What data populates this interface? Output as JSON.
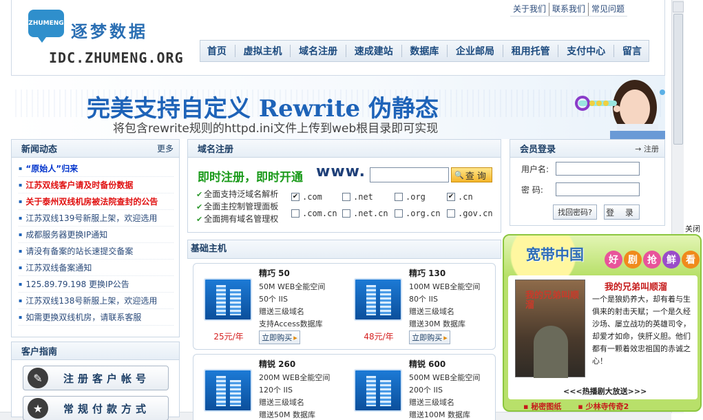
{
  "logo": {
    "bubble": "ZHUMENG",
    "cn": "逐梦数据",
    "en": "IDC.ZHUMENG.ORG"
  },
  "toplinks": [
    "关于我们",
    "联系我们",
    "常见问题"
  ],
  "nav": [
    "首页",
    "虚拟主机",
    "域名注册",
    "速成建站",
    "数据库",
    "企业邮局",
    "租用托管",
    "支付中心",
    "留言"
  ],
  "banner": {
    "title": "完美支持自定义 Rewrite 伪静态",
    "subtitle": "将包含rewrite规则的httpd.ini文件上传到web根目录即可实现"
  },
  "news": {
    "title": "新闻动态",
    "more": "更多",
    "items": [
      {
        "text": "“原始人”归来",
        "style": "bold blue"
      },
      {
        "text": "江苏双线客户请及时备份数据",
        "style": "bold red"
      },
      {
        "text": "关于泰州双线机房被法院查封的公告",
        "style": "bold red"
      },
      {
        "text": "江苏双线139号新服上架，欢迎选用",
        "style": ""
      },
      {
        "text": "成都服务器更换IP通知",
        "style": ""
      },
      {
        "text": "请没有备案的站长速提交备案",
        "style": ""
      },
      {
        "text": "江苏双线备案通知",
        "style": ""
      },
      {
        "text": "125.89.79.198 更换IP公告",
        "style": ""
      },
      {
        "text": "江苏双线138号新服上架，欢迎选用",
        "style": ""
      },
      {
        "text": "如需更换双线机房，请联系客服",
        "style": ""
      }
    ]
  },
  "guide": {
    "title": "客户指南",
    "buttons": [
      {
        "label": "注册客户帐号",
        "icon": "wrench-icon"
      },
      {
        "label": "常规付款方式",
        "icon": "star-icon"
      }
    ]
  },
  "domain": {
    "title": "域名注册",
    "slogan": "即时注册，即时开通",
    "www": "www.",
    "input_value": "",
    "query_label": "查询",
    "features": [
      "全面支持泛域名解析",
      "全面主控制管理面板",
      "全面拥有域名管理权"
    ],
    "tlds": [
      {
        "name": ".com",
        "checked": true
      },
      {
        "name": ".net",
        "checked": false
      },
      {
        "name": ".org",
        "checked": false
      },
      {
        "name": ".cn",
        "checked": true
      },
      {
        "name": ".com.cn",
        "checked": false
      },
      {
        "name": ".net.cn",
        "checked": false
      },
      {
        "name": ".org.cn",
        "checked": false
      },
      {
        "name": ".gov.cn",
        "checked": false
      }
    ]
  },
  "hosting": {
    "title": "基础主机",
    "plans": [
      {
        "name": "精巧 50",
        "specs": [
          "50M WEB全能空间",
          "50个 IIS",
          "赠送三级域名",
          "支持Access数据库"
        ],
        "price": "25元/年",
        "buy": "立即购买"
      },
      {
        "name": "精巧 130",
        "specs": [
          "100M WEB全能空间",
          "80个 IIS",
          "赠送三级域名",
          "赠送30M 数据库"
        ],
        "price": "48元/年",
        "buy": "立即购买"
      },
      {
        "name": "精锐 260",
        "specs": [
          "200M WEB全能空间",
          "120个 IIS",
          "赠送三级域名",
          "赠送50M 数据库"
        ],
        "price": "",
        "buy": ""
      },
      {
        "name": "精锐 600",
        "specs": [
          "500M WEB全能空间",
          "200个 IIS",
          "赠送三级域名",
          "赠送100M 数据库"
        ],
        "price": "",
        "buy": ""
      }
    ]
  },
  "login": {
    "title": "会员登录",
    "register": "注册",
    "username_label": "用户名:",
    "password_label": "密  码:",
    "forgot": "找回密码?",
    "submit": "登 录"
  },
  "ad": {
    "close": "关闭",
    "brand": "宽带中国",
    "tags": [
      "好",
      "剧",
      "抢",
      "鲜",
      "看"
    ],
    "tag_colors": [
      "#e8539a",
      "#f08a1c",
      "#e8539a",
      "#9a4cc9",
      "#f08a1c"
    ],
    "poster_title": "我的兄弟叫顺溜",
    "name": "我的兄弟叫顺溜",
    "desc": "一个是狼奶养大，却有着与生俱来的射击天赋；一个是久经沙场、屡立战功的英雄司令，却爱才如命，侠肝义胆。他们都有一颗着效忠祖国的赤诚之心！",
    "hot": "<<<热播剧大放送>>>",
    "links": [
      "秘密图纸",
      "少林寺传奇2"
    ]
  }
}
